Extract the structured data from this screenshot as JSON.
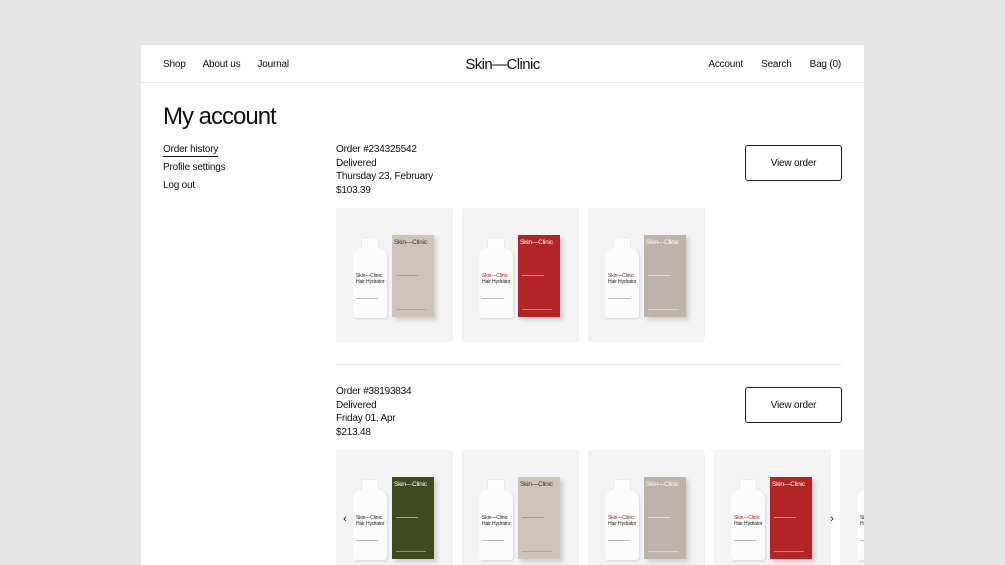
{
  "header": {
    "logo": "Skin—Clinic",
    "nav_left": [
      "Shop",
      "About us",
      "Journal"
    ],
    "nav_right": [
      "Account",
      "Search",
      "Bag (0)"
    ]
  },
  "page_title": "My account",
  "side_menu": [
    "Order history",
    "Profile settings",
    "Log out"
  ],
  "view_order_label": "View order",
  "orders": [
    {
      "number": "Order #234325542",
      "status": "Delivered",
      "date": "Thursday 23, February",
      "total": "$103.39",
      "products": [
        {
          "box_color": "beige",
          "brand": "Skin—Clinic",
          "bottle_label": "Skin—Clinic",
          "bottle_sub": "Hair Hydrator"
        },
        {
          "box_color": "red",
          "brand": "Skin—Clinic",
          "bottle_label": "Skin—Clinic",
          "bottle_sub": "Hair Hydrator"
        },
        {
          "box_color": "taupe",
          "brand": "Skin—Clinic",
          "bottle_label": "Skin—Clinic",
          "bottle_sub": "Hair Hydrator"
        }
      ]
    },
    {
      "number": "Order #38193834",
      "status": "Delivered",
      "date": "Friday 01, Apr",
      "total": "$213.48",
      "products": [
        {
          "box_color": "green",
          "brand": "Skin—Clinic",
          "bottle_label": "Skin—Clinic",
          "bottle_sub": "Hair Hydrator"
        },
        {
          "box_color": "beige",
          "brand": "Skin—Clinic",
          "bottle_label": "Skin—Clinic",
          "bottle_sub": "Hair Hydrator"
        },
        {
          "box_color": "taupe",
          "brand": "Skin—Clinic",
          "bottle_label": "Skin—Clinic",
          "bottle_sub": "Hair Hydrator"
        },
        {
          "box_color": "red",
          "brand": "Skin—Clinic",
          "bottle_label": "Skin—Clinic",
          "bottle_sub": "Hair Hydrator"
        },
        {
          "box_color": "beige",
          "brand": "Skin—Clinic",
          "bottle_label": "Skin—Clinic",
          "bottle_sub": "Hair Hydrator"
        }
      ]
    }
  ],
  "carousel": {
    "prev_icon": "chevron-left-icon",
    "next_icon": "chevron-right-icon",
    "prev": "‹",
    "next": "›"
  },
  "colors": {
    "red_box": "#b22426",
    "green_box": "#3f4a1f",
    "beige_box": "#cdc5b8",
    "taupe_box": "#bcb4aa",
    "background": "#e6e6e6"
  }
}
